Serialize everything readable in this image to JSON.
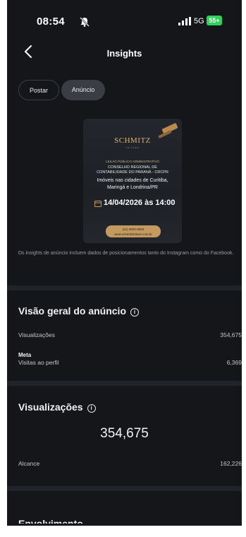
{
  "status_bar": {
    "time": "08:54",
    "network": "5G",
    "battery": "55+"
  },
  "nav": {
    "title": "Insights"
  },
  "tabs": [
    {
      "label": "Postar"
    },
    {
      "label": "Anúncio"
    }
  ],
  "ad_creative": {
    "brand": "SCHMITZ",
    "brand_subtitle": "LEILÕES",
    "line1": "LEILÃO PÚBLICO ADMINISTRATIVO",
    "line2": "CONSELHO REGIONAL DE",
    "line3": "CONTABILIDADE DO PARANÁ - CRCPR",
    "line4": "Imóveis nas cidades de Curitiba,",
    "line5": "Maringá e Londrina/PR",
    "date": "14/04/2026 às 14:00",
    "button_line1": "(41) 3000-0000",
    "button_line2": "www.schmitzleiloes.com.br"
  },
  "note": "Os insights de anúncio incluem dados de posicionamentos tanto do Instagram como do Facebook.",
  "overview": {
    "title": "Visão geral do anúncio",
    "views_label": "Visualizações",
    "views_value": "354,675",
    "goal_label": "Meta",
    "profile_visits_label": "Visitas ao perfil",
    "profile_visits_value": "6,369"
  },
  "views_section": {
    "title": "Visualizações",
    "total": "354,675",
    "reach_label": "Alcance",
    "reach_value": "162,226"
  },
  "next_section": {
    "title": "Envolvimento"
  },
  "colors": {
    "background": "#14161a",
    "divider": "#202329",
    "battery": "#2fd158",
    "ad_accent": "#c49a5f"
  }
}
